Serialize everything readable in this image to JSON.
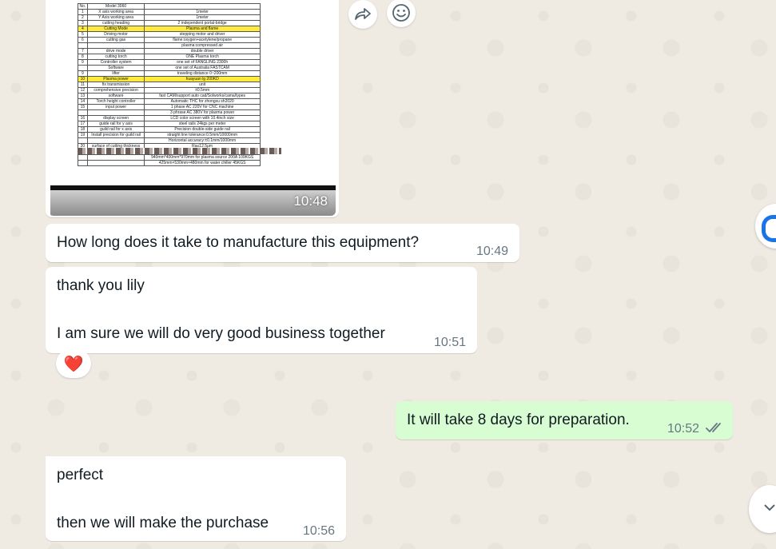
{
  "image_message": {
    "time": "10:48",
    "spec_rows": [
      [
        "No.",
        "Model 3060",
        ""
      ],
      [
        "1",
        "X axis working area",
        "1meter"
      ],
      [
        "2",
        "Y Axis working area",
        "1meter"
      ],
      [
        "3",
        "cutting heading",
        "2 independent portal-bridge"
      ],
      [
        "4",
        "Cutting Mode",
        "Plasma and flame"
      ],
      [
        "5",
        "Driving motor",
        "stepping motor and driver"
      ],
      [
        "6",
        "cutting gas",
        "flame:oxygen+acetylene/propane"
      ],
      [
        "",
        "",
        "plasma:compressed air"
      ],
      [
        "7",
        "drive mode",
        "double driver"
      ],
      [
        "8",
        "cutting torch",
        "ONE Plasma torch"
      ],
      [
        "9",
        "Controller system",
        "one set of FANGLING 2300h"
      ],
      [
        "",
        "Software",
        "one set of Australia FASTCAM"
      ],
      [
        "9",
        "lifter",
        "traveling distance 0~200mm"
      ],
      [
        "10",
        "Plasma power",
        "huayuan lg 200KD"
      ],
      [
        "11",
        "fix transmission",
        "unit"
      ],
      [
        "12",
        "comprehensive precision",
        "±0.5mm"
      ],
      [
        "13",
        "software",
        "fast CAM/support auto cad/Solworks/cama/types"
      ],
      [
        "14",
        "Torch height controller",
        "Automatic THC for zhongxu sh2020"
      ],
      [
        "15",
        "input power",
        "1 phase AC 220V for CNC machine"
      ],
      [
        "",
        "",
        "3 phrase AC 380V for plasma power"
      ],
      [
        "16",
        "display screen",
        "LCD color screen with 10.4inch size"
      ],
      [
        "17",
        "guide rail for y axis",
        "steel rails 24kgs per meter"
      ],
      [
        "18",
        "guild rail for x axis",
        "Precision double-side guide rail"
      ],
      [
        "19",
        "Install precision for guild rail",
        "straight line tolerance:0.5mm/10000mm"
      ],
      [
        "",
        "",
        "Horizontal accuracy:±0.1mm/1000mm"
      ],
      [
        "20",
        "surface of cutting thickness",
        "Ra≤12.5μm"
      ],
      [
        "21",
        "Package size(L*W*H)",
        "4100MMX1700MMX1500MM CNC PLASMA 480kGS"
      ],
      [
        "",
        "",
        "940mm*400mm*970mm for plasma source 200A 109KGS"
      ],
      [
        "",
        "",
        "425mm×530mm×480mm for water chiller 45KGS"
      ]
    ],
    "highlight_rows": [
      4,
      13
    ]
  },
  "messages": [
    {
      "direction": "in",
      "lines": [
        "How long does it take to manufacture this equipment?"
      ],
      "time": "10:49"
    },
    {
      "direction": "in",
      "lines": [
        "thank you lily",
        "",
        "I am sure we will do very good business together"
      ],
      "time": "10:51",
      "reaction": "❤️"
    },
    {
      "direction": "out",
      "lines": [
        "It will take 8 days for preparation."
      ],
      "time": "10:52",
      "status": "read"
    },
    {
      "direction": "in",
      "lines": [
        "perfect",
        "",
        "then we will make the purchase"
      ],
      "time": "10:56"
    }
  ],
  "icons": {
    "forward": "forward-icon",
    "emoji": "emoji-icon",
    "read_receipt": "double-check-icon",
    "scroll_down": "chevron-down-icon"
  },
  "colors": {
    "background": "#efeae2",
    "incoming": "#ffffff",
    "outgoing": "#d9fdd3",
    "read_check": "#53bdeb",
    "highlight": "#ffeb3b"
  }
}
